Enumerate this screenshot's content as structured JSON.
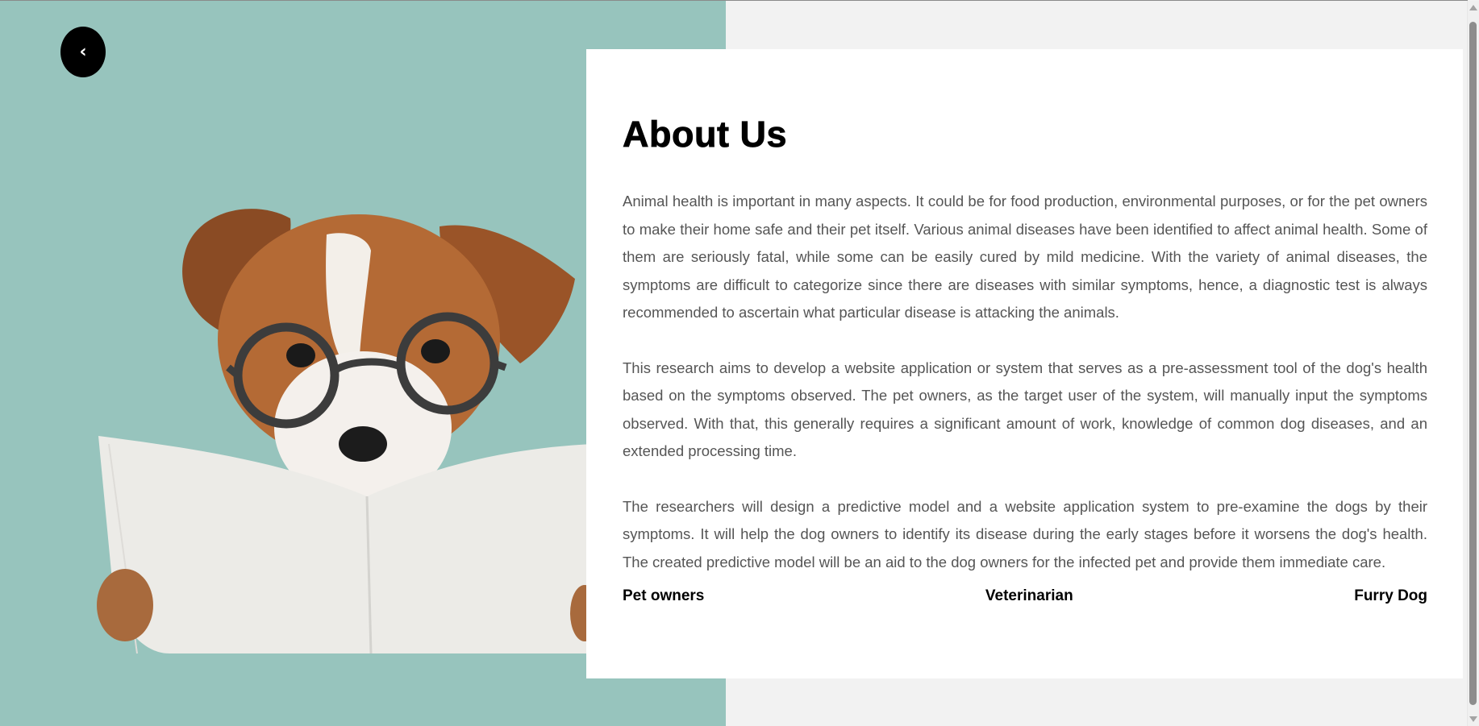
{
  "nav": {
    "back_label": "‹"
  },
  "about": {
    "title": "About Us",
    "paragraphs": [
      "Animal health is important in many aspects. It could be for food production, environmental purposes, or for the pet owners to make their home safe and their pet itself. Various animal diseases have been identified to affect animal health. Some of them are seriously fatal, while some can be easily cured by mild medicine. With the variety of animal diseases, the symptoms are difficult to categorize since there are diseases with similar symptoms, hence, a diagnostic test is always recommended to ascertain what particular disease is attacking the animals.",
      "This research aims to develop a website application or system that serves as a pre-assessment tool of the dog's health based on the symptoms observed. The pet owners, as the target user of the system, will manually input the symptoms observed. With that, this generally requires a significant amount of work, knowledge of common dog diseases, and an extended processing time.",
      "The researchers will design a predictive model and a website application system to pre-examine the dogs by their symptoms. It will help the dog owners to identify its disease during the early stages before it worsens the dog's health. The created predictive model will be an aid to the dog owners for the infected pet and provide them immediate care."
    ],
    "tags": [
      "Pet owners",
      "Veterinarian",
      "Furry Dog"
    ]
  },
  "colors": {
    "hero_background": "#97c4bd",
    "card_background": "#ffffff",
    "page_background": "#f2f2f2",
    "body_text": "#555555"
  },
  "icons": {
    "back": "chevron-left-icon",
    "illustration": "puppy-reading-newspaper"
  }
}
